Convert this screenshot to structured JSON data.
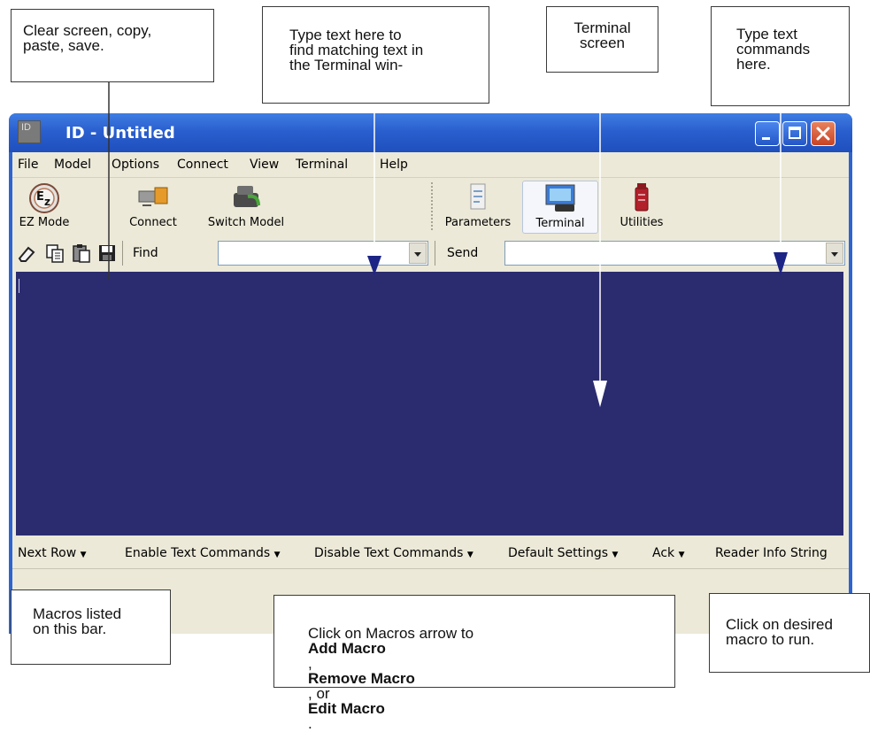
{
  "window": {
    "icon_text": "ID",
    "title": "ID - Untitled"
  },
  "menu": [
    "File",
    "Model",
    "Options",
    "Connect",
    "View",
    "Terminal",
    "Help"
  ],
  "toolbar": {
    "ez_mode": "EZ Mode",
    "connect": "Connect",
    "switch_model": "Switch Model",
    "parameters": "Parameters",
    "terminal": "Terminal",
    "utilities": "Utilities"
  },
  "findbar": {
    "find_label": "Find",
    "find_value": "",
    "send_label": "Send",
    "send_value": ""
  },
  "macros": [
    "Next Row",
    "Enable Text Commands",
    "Disable Text Commands",
    "Default Settings",
    "Ack",
    "Reader Info String"
  ],
  "callouts": {
    "clear": [
      "Clear screen, copy,",
      "paste, save."
    ],
    "find": [
      "Type text here to",
      "find matching text in",
      "the Terminal win-"
    ],
    "terminal": [
      "Terminal",
      "screen"
    ],
    "send": [
      "Type text",
      "commands",
      "here."
    ],
    "macros_bar": [
      "Macros listed",
      "on this bar."
    ],
    "macros_arrow": {
      "t1": "Click on Macros arrow to ",
      "b1": "Add Macro",
      "t2": ",",
      "b2": "Remove Macro",
      "t3": ", or ",
      "b3": "Edit Macro",
      "t4": "."
    },
    "run": [
      "Click on desired",
      "macro to run."
    ]
  },
  "colors": {
    "terminal_bg": "#2b2c6f",
    "titlebar": "#2a5fcf",
    "window_bg": "#ece9d8",
    "close_btn": "#d4552f"
  }
}
